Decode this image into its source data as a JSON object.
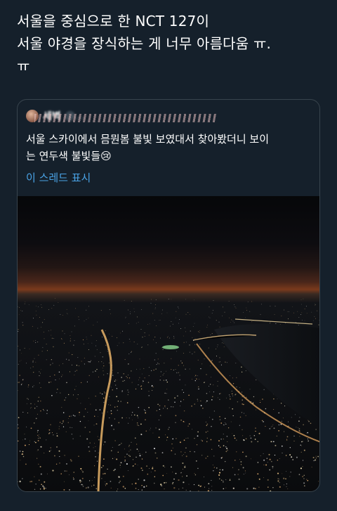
{
  "tweet": {
    "text": "서울을 중심으로 한 NCT 127이\n서울 야경을 장식하는 게 너무 아름다움 ㅠ.\nㅠ"
  },
  "quoted_tweet": {
    "author_name": "세벽",
    "handle": "@...",
    "text": "서울 스카이에서 믐뭔봄 불빛 보였대서 찾아봤더니 보이\n는 연두색 불빛들😢",
    "show_thread": "이 스레드 표시",
    "image": "night-city-aerial-photo"
  },
  "colors": {
    "background": "#15202b",
    "border": "#38444d",
    "link": "#4aa3e6",
    "secondary_text": "#8899a6"
  }
}
